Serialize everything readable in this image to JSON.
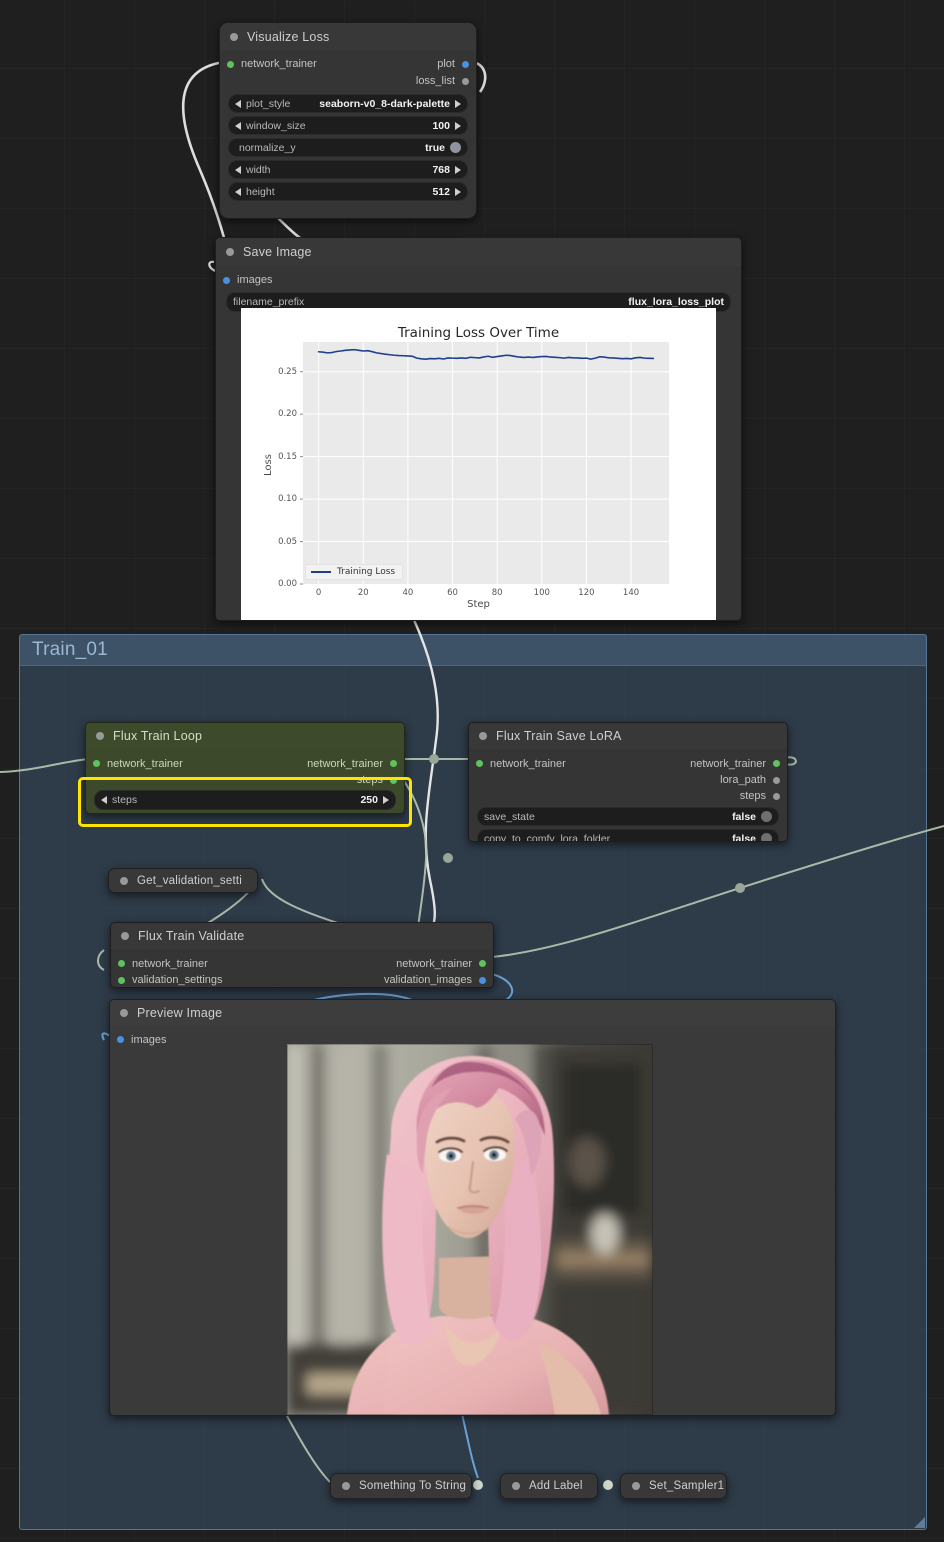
{
  "canvas": {
    "background_color": "#1f1f1f",
    "grid_color": "#2a2a2a"
  },
  "group": {
    "title": "Train_01",
    "color": "#3a5269",
    "border_color": "#78a5cd"
  },
  "nodes": {
    "visualize_loss": {
      "title": "Visualize Loss",
      "inputs": [
        {
          "label": "network_trainer",
          "type": "green"
        }
      ],
      "outputs": [
        {
          "label": "plot",
          "type": "blue"
        },
        {
          "label": "loss_list",
          "type": "grey"
        }
      ],
      "widgets": [
        {
          "name": "plot_style",
          "value": "seaborn-v0_8-dark-palette",
          "kind": "combo"
        },
        {
          "name": "window_size",
          "value": "100",
          "kind": "number"
        },
        {
          "name": "normalize_y",
          "value": "true",
          "kind": "toggle"
        },
        {
          "name": "width",
          "value": "768",
          "kind": "number"
        },
        {
          "name": "height",
          "value": "512",
          "kind": "number"
        }
      ]
    },
    "save_image": {
      "title": "Save Image",
      "inputs": [
        {
          "label": "images",
          "type": "blue"
        }
      ],
      "widgets": [
        {
          "name": "filename_prefix",
          "value": "flux_lora_loss_plot",
          "kind": "text"
        }
      ]
    },
    "flux_train_loop": {
      "title": "Flux Train Loop",
      "inputs": [
        {
          "label": "network_trainer",
          "type": "green"
        }
      ],
      "outputs": [
        {
          "label": "network_trainer",
          "type": "green"
        },
        {
          "label": "steps",
          "type": "green"
        }
      ],
      "widgets": [
        {
          "name": "steps",
          "value": "250",
          "kind": "number"
        }
      ],
      "highlighted_widget": "steps"
    },
    "flux_train_save_lora": {
      "title": "Flux Train Save LoRA",
      "inputs": [
        {
          "label": "network_trainer",
          "type": "green"
        }
      ],
      "outputs": [
        {
          "label": "network_trainer",
          "type": "green"
        },
        {
          "label": "lora_path",
          "type": "grey"
        },
        {
          "label": "steps",
          "type": "grey"
        }
      ],
      "widgets": [
        {
          "name": "save_state",
          "value": "false",
          "kind": "toggle"
        },
        {
          "name": "copy_to_comfy_lora_folder",
          "value": "false",
          "kind": "toggle"
        }
      ]
    },
    "get_validation_settings": {
      "title": "Get_validation_setti",
      "collapsed": true
    },
    "flux_train_validate": {
      "title": "Flux Train Validate",
      "inputs": [
        {
          "label": "network_trainer",
          "type": "green"
        },
        {
          "label": "validation_settings",
          "type": "green"
        }
      ],
      "outputs": [
        {
          "label": "network_trainer",
          "type": "green"
        },
        {
          "label": "validation_images",
          "type": "blue"
        }
      ]
    },
    "preview_image": {
      "title": "Preview Image",
      "inputs": [
        {
          "label": "images",
          "type": "blue"
        }
      ],
      "image_alt": "Validation preview: portrait of a woman with long pink hair wearing a pink tank top, blurred indoor background"
    },
    "something_to_string": {
      "title": "Something To String",
      "collapsed": true
    },
    "add_label": {
      "title": "Add Label",
      "collapsed": true
    },
    "set_sampler1": {
      "title": "Set_Sampler1",
      "collapsed": true
    }
  },
  "chart_data": {
    "type": "line",
    "title": "Training Loss Over Time",
    "xlabel": "Step",
    "ylabel": "Loss",
    "xlim": [
      -7,
      157
    ],
    "ylim": [
      0.0,
      0.285
    ],
    "xticks": [
      0,
      20,
      40,
      60,
      80,
      100,
      120,
      140
    ],
    "yticks": [
      "0.00",
      "0.05",
      "0.10",
      "0.15",
      "0.20",
      "0.25"
    ],
    "ytick_values": [
      0.0,
      0.05,
      0.1,
      0.15,
      0.2,
      0.25
    ],
    "grid": true,
    "legend": {
      "position": "lower left",
      "entries": [
        "Training Loss"
      ]
    },
    "series": [
      {
        "name": "Training Loss",
        "color": "#1f3f8f",
        "x": [
          0,
          2,
          4,
          6,
          8,
          10,
          12,
          14,
          16,
          18,
          20,
          22,
          24,
          26,
          28,
          30,
          32,
          34,
          36,
          38,
          40,
          42,
          44,
          46,
          48,
          50,
          52,
          54,
          56,
          58,
          60,
          62,
          64,
          66,
          68,
          70,
          72,
          74,
          76,
          78,
          80,
          82,
          84,
          86,
          88,
          90,
          92,
          94,
          96,
          98,
          100,
          102,
          104,
          106,
          108,
          110,
          112,
          114,
          116,
          118,
          120,
          122,
          124,
          126,
          128,
          130,
          132,
          134,
          136,
          138,
          140,
          142,
          144,
          146,
          148,
          150
        ],
        "values": [
          0.2735,
          0.273,
          0.2722,
          0.2726,
          0.2738,
          0.2744,
          0.2752,
          0.2757,
          0.276,
          0.2752,
          0.2744,
          0.2748,
          0.2736,
          0.2722,
          0.2714,
          0.2706,
          0.27,
          0.2694,
          0.269,
          0.2688,
          0.2686,
          0.2682,
          0.266,
          0.2652,
          0.2648,
          0.2655,
          0.2652,
          0.2658,
          0.265,
          0.2662,
          0.266,
          0.2658,
          0.2662,
          0.2658,
          0.267,
          0.2666,
          0.2662,
          0.2674,
          0.2682,
          0.267,
          0.2678,
          0.2686,
          0.2694,
          0.269,
          0.268,
          0.2672,
          0.2668,
          0.2672,
          0.2668,
          0.2674,
          0.2678,
          0.268,
          0.2672,
          0.267,
          0.2666,
          0.266,
          0.2668,
          0.2664,
          0.2662,
          0.2658,
          0.266,
          0.2648,
          0.266,
          0.2676,
          0.2672,
          0.2664,
          0.2662,
          0.2658,
          0.2654,
          0.2656,
          0.2652,
          0.2664,
          0.2668,
          0.266,
          0.2658,
          0.2656
        ]
      }
    ]
  }
}
